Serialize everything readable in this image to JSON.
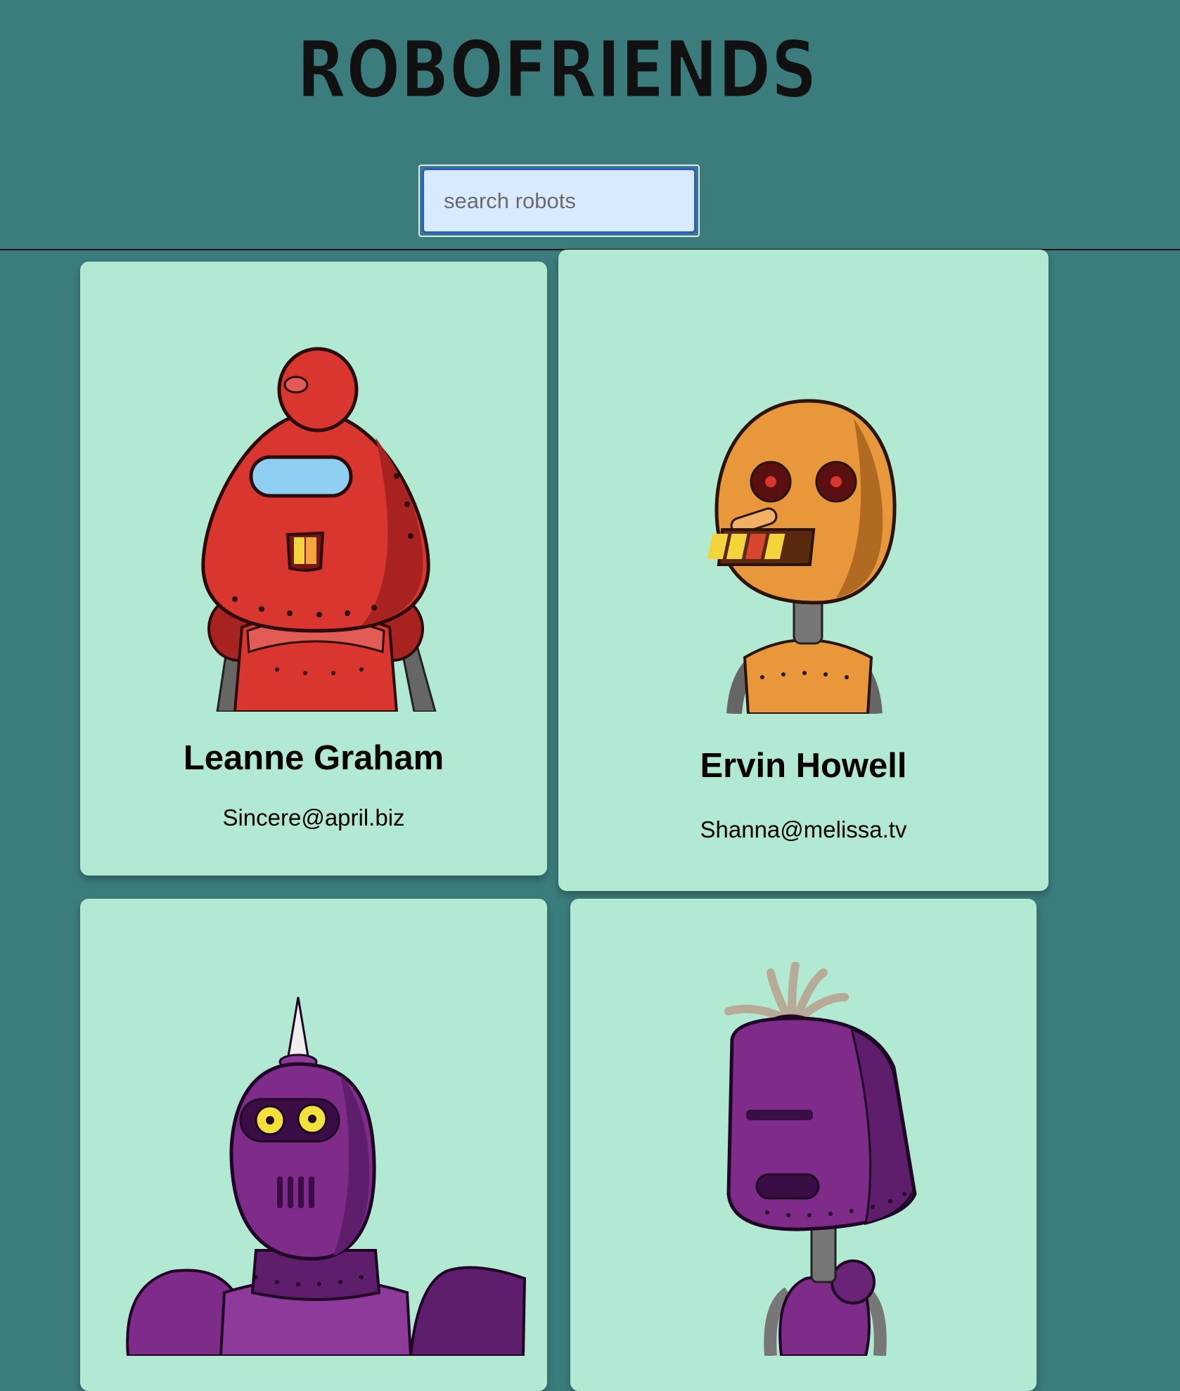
{
  "header": {
    "title": "ROBOFRIENDS"
  },
  "search": {
    "placeholder": "search robots",
    "value": ""
  },
  "robots": [
    {
      "name": "Leanne Graham",
      "email": "Sincere@april.biz",
      "color": "#d8362f"
    },
    {
      "name": "Ervin Howell",
      "email": "Shanna@melissa.tv",
      "color": "#e8973a"
    },
    {
      "name": "",
      "email": "",
      "color": "#7e2b8a"
    },
    {
      "name": "",
      "email": "",
      "color": "#7e2b8a"
    }
  ],
  "colors": {
    "background": "#3b7c7c",
    "card": "#b2e9d2",
    "search_fill": "#d8eafd",
    "search_border": "#2a5bd0"
  }
}
